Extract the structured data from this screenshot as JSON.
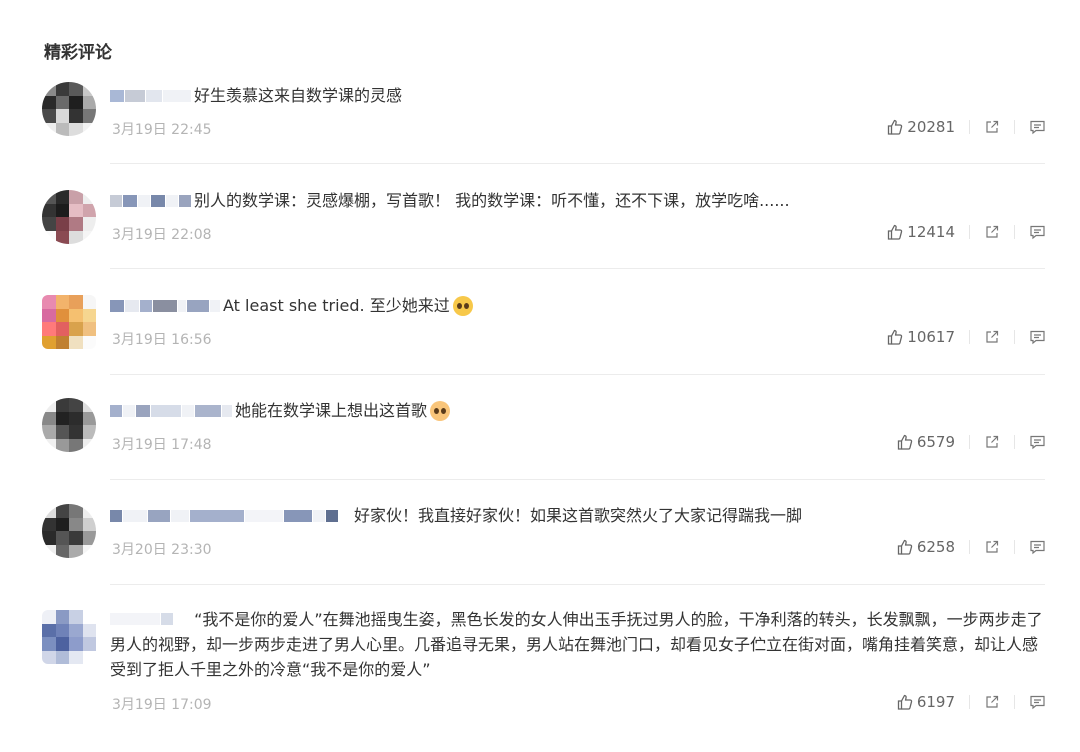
{
  "section_title": "精彩评论",
  "comments": [
    {
      "text": "好生羡慕这来自数学课的灵感",
      "time": "3月19日 22:45",
      "likes": "20281"
    },
    {
      "text": "别人的数学课：灵感爆棚，写首歌！ 我的数学课：听不懂，还不下课，放学吃啥......",
      "time": "3月19日 22:08",
      "likes": "12414"
    },
    {
      "text": "At least she tried. 至少她来过",
      "emoji": "pleading-face-emoji",
      "time": "3月19日 16:56",
      "likes": "10617"
    },
    {
      "text": "她能在数学课上想出这首歌",
      "emoji": "flushed-face-emoji",
      "time": "3月19日 17:48",
      "likes": "6579"
    },
    {
      "text": "好家伙！我直接好家伙！如果这首歌突然火了大家记得踹我一脚",
      "time": "3月20日 23:30",
      "likes": "6258"
    },
    {
      "text": "“我不是你的爱人”在舞池摇曳生姿，黑色长发的女人伸出玉手抚过男人的脸，干净利落的转头，长发飘飘，一步两步走了男人的视野，却一步两步走进了男人心里。几番追寻无果，男人站在舞池门口，却看见女子伫立在街对面，嘴角挂着笑意，却让人感受到了拒人千里之外的冷意“我不是你的爱人”",
      "time": "3月19日 17:09",
      "likes": "6197"
    }
  ],
  "icons": {
    "like": "thumbs-up-icon",
    "share": "share-icon",
    "reply": "reply-icon"
  },
  "colors": {
    "text": "#333333",
    "meta": "#b4b4b4",
    "divider": "#ececec"
  }
}
